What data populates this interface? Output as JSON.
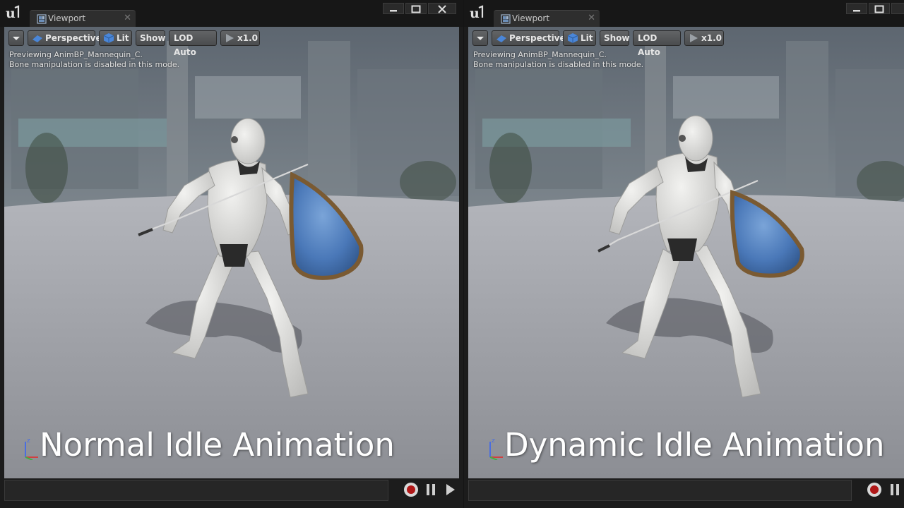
{
  "left": {
    "tab_label": "Viewport",
    "toolbar": {
      "perspective": "Perspective",
      "lit": "Lit",
      "show": "Show",
      "lod": "LOD Auto",
      "speed": "x1.0"
    },
    "info_line1": "Previewing AnimBP_Mannequin_C.",
    "info_line2": "Bone manipulation is disabled in this mode.",
    "caption": "Normal Idle Animation"
  },
  "right": {
    "tab_label": "Viewport",
    "toolbar": {
      "perspective": "Perspective",
      "lit": "Lit",
      "show": "Show",
      "lod": "LOD Auto",
      "speed": "x1.0"
    },
    "info_line1": "Previewing AnimBP_Mannequin_C.",
    "info_line2": "Bone manipulation is disabled in this mode.",
    "caption": "Dynamic Idle Animation"
  },
  "icons": [
    "unreal-logo-icon",
    "viewport-tab-icon",
    "dropdown-arrow-icon",
    "perspective-icon",
    "lit-cube-icon",
    "speed-play-icon",
    "axis-gizmo-icon",
    "record-icon",
    "pause-icon",
    "play-icon"
  ],
  "colors": {
    "accent_blue": "#4a86d8",
    "record_red": "#b01818",
    "shield_blue": "#4a78b8",
    "shield_rim": "#7a5a32"
  }
}
